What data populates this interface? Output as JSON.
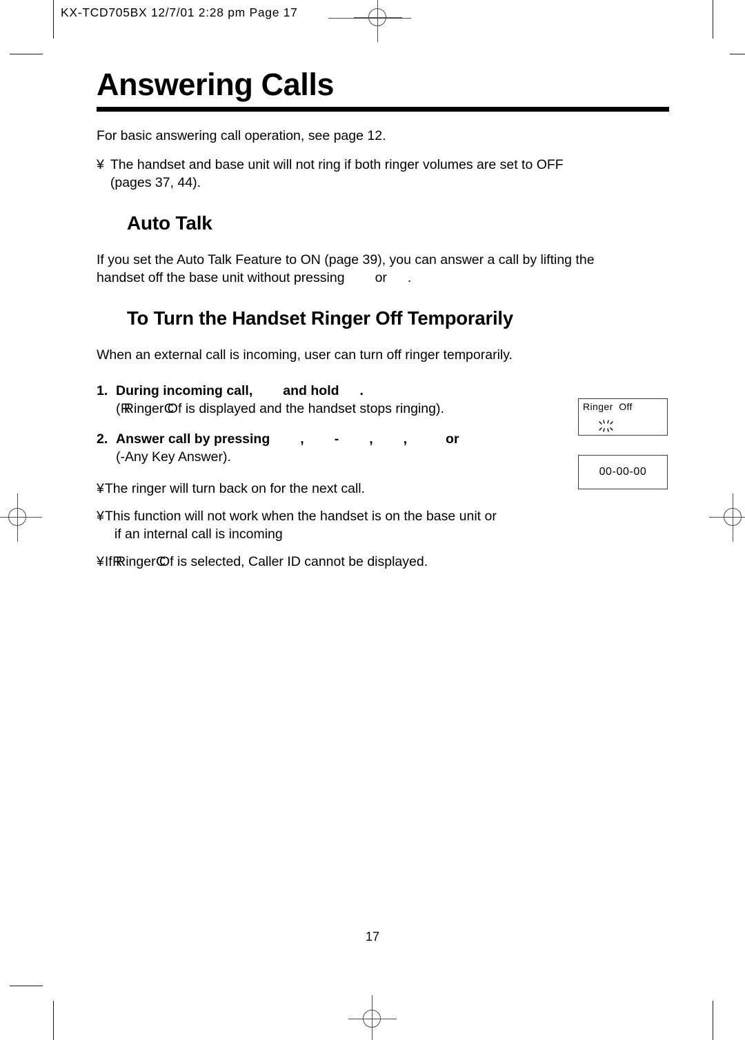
{
  "header": {
    "running_head": "KX-TCD705BX   12/7/01  2:28 pm  Page 17"
  },
  "title": "Answering Calls",
  "intro": {
    "line": "For basic answering call operation, see page 12.",
    "bullet_mark": "¥",
    "note_part1": "The handset and base unit will not ring if both ringer volumes are set to OFF",
    "note_part2": "(pages 37, 44)."
  },
  "auto_talk": {
    "heading": "Auto Talk",
    "paragraph_1": "If you set the Auto Talk Feature to ON (page 39), you can answer a call by lifting the",
    "paragraph_2_before": "handset off the base unit without pressing",
    "paragraph_2_or": "or",
    "paragraph_2_after": "."
  },
  "ringer_off": {
    "heading": "To Turn the Handset Ringer Off Temporarily",
    "intro": "When an external call is incoming, user can turn off ringer temporarily.",
    "steps": [
      {
        "number": "1.",
        "bold_before": "During incoming call,",
        "bold_after": "and hold",
        "bold_period": ".",
        "sub_open": "(",
        "sub_label_a": "Ri",
        "sub_label_a_over": "R",
        "sub_label_b": "nger",
        "sub_label_c": "O",
        "sub_label_c_over": "C",
        "sub_label_d": "f",
        "sub_rest": "is displayed and the handset stops ringing)."
      },
      {
        "number": "2.",
        "bold_before": "Answer call by pressing",
        "sep_comma": ",",
        "sep_hyphen": "-",
        "bold_or": "or",
        "sub": "(-Any Key Answer)."
      }
    ],
    "notes": [
      {
        "mark": "¥",
        "text": "The ringer will turn back on for the next call."
      },
      {
        "mark": "¥",
        "text": "This function will not work when the handset is on the base unit or",
        "text_cont": "if an internal call is incoming"
      },
      {
        "mark": "¥",
        "prefix": "If",
        "label_a": "Ri",
        "label_a_over": "R",
        "label_b": "nger",
        "label_c": "O",
        "label_c_over": "C",
        "label_d": "f",
        "suffix": "is selected, Caller ID cannot be displayed."
      }
    ]
  },
  "lcd_displays": [
    {
      "name": "ringer-off-display",
      "text": "Ringer  Off",
      "indicator": "blinking-icon"
    },
    {
      "name": "clock-display",
      "text": "00-00-00"
    }
  ],
  "folio": "17"
}
